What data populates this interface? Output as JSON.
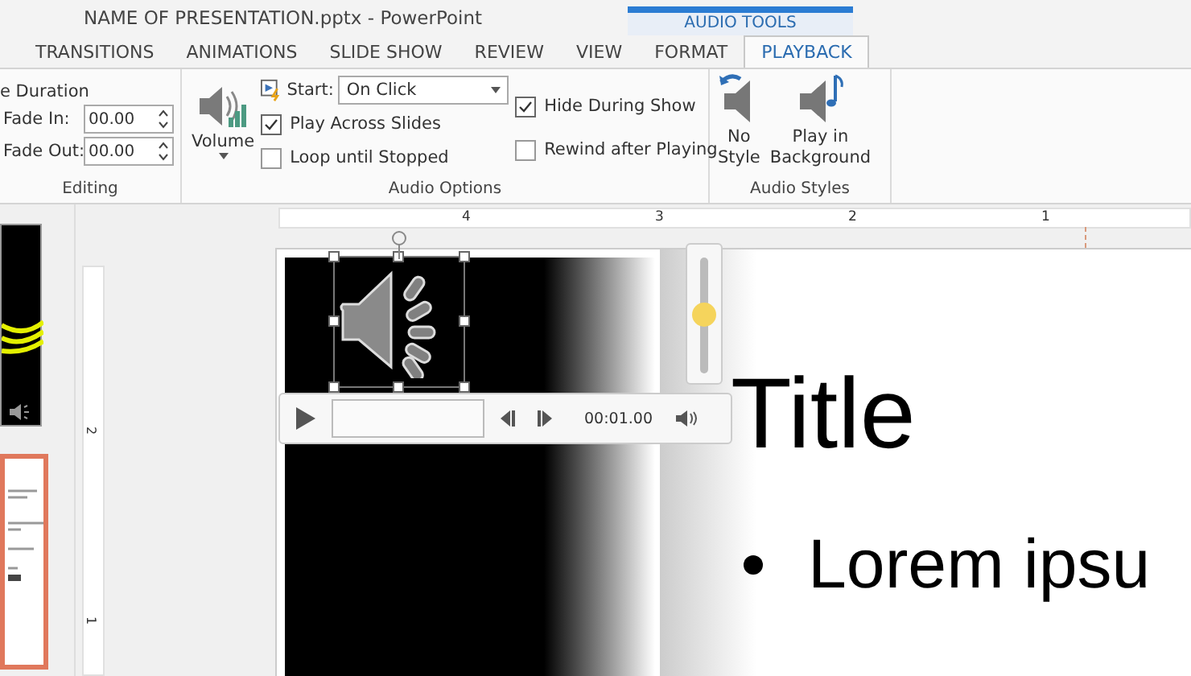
{
  "title_bar": {
    "document_title": "NAME OF PRESENTATION.pptx - PowerPoint",
    "contextual_group": "AUDIO TOOLS"
  },
  "tabs": [
    {
      "label": "TRANSITIONS",
      "selected": false
    },
    {
      "label": "ANIMATIONS",
      "selected": false
    },
    {
      "label": "SLIDE SHOW",
      "selected": false
    },
    {
      "label": "REVIEW",
      "selected": false
    },
    {
      "label": "VIEW",
      "selected": false
    },
    {
      "label": "FORMAT",
      "selected": false
    },
    {
      "label": "PLAYBACK",
      "selected": true
    }
  ],
  "ribbon": {
    "editing": {
      "heading": "e Duration",
      "fade_in": {
        "label": "Fade In:",
        "value": "00.00"
      },
      "fade_out": {
        "label": "Fade Out:",
        "value": "00.00"
      },
      "group_label": "Editing"
    },
    "audio_options": {
      "volume_label": "Volume",
      "start": {
        "label": "Start:",
        "value": "On Click"
      },
      "checkboxes": [
        {
          "label": "Play Across Slides",
          "checked": true
        },
        {
          "label": "Loop until Stopped",
          "checked": false
        }
      ],
      "right_checkboxes": [
        {
          "label": "Hide During Show",
          "checked": true
        },
        {
          "label": "Rewind after Playing",
          "checked": false
        }
      ],
      "group_label": "Audio Options"
    },
    "audio_styles": {
      "buttons": [
        {
          "kind": "no_style",
          "lines": [
            "No",
            "Style"
          ]
        },
        {
          "kind": "background",
          "lines": [
            "Play in",
            "Background"
          ]
        }
      ],
      "group_label": "Audio Styles"
    }
  },
  "horizontal_ruler": [
    "4",
    "3",
    "2",
    "1"
  ],
  "vertical_ruler": [
    "2",
    "1"
  ],
  "thumbnails": [
    {
      "kind": "dark",
      "selected": false
    },
    {
      "kind": "light",
      "selected": true
    }
  ],
  "audio_player": {
    "time": "00:01.00",
    "volume": {
      "level": 0.5
    }
  },
  "slide": {
    "title": "Title",
    "bullet": "Lorem ipsu"
  }
}
